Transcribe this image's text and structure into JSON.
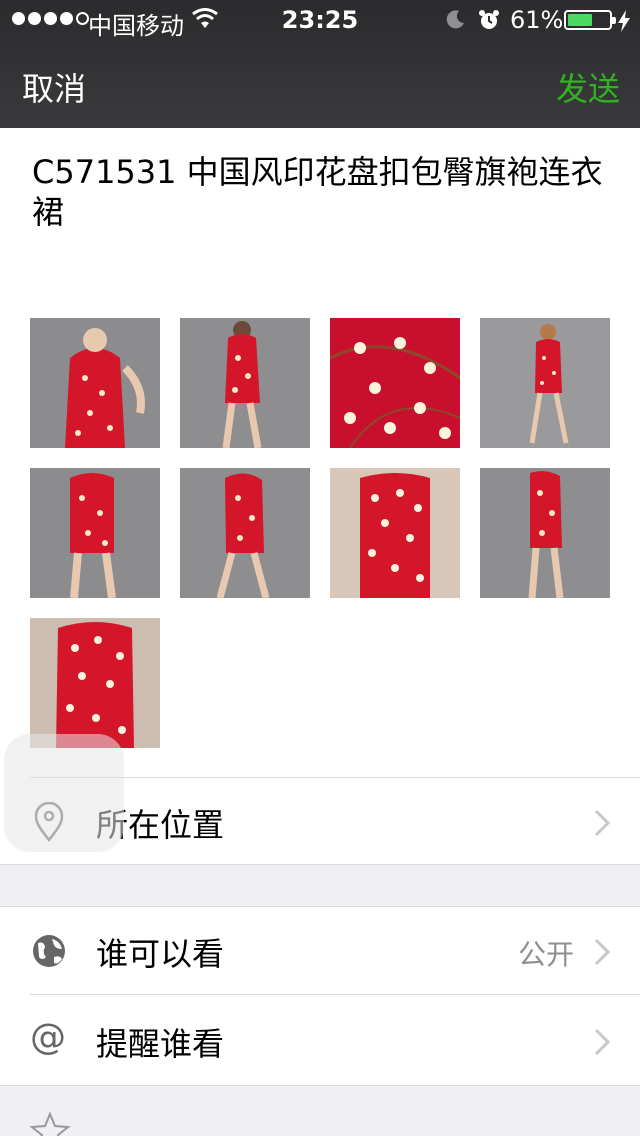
{
  "status_bar": {
    "carrier": "中国移动",
    "time": "23:25",
    "battery_percent": "61%",
    "battery_level": 0.61,
    "signal_bars": 4,
    "signal_total": 5
  },
  "nav": {
    "cancel_label": "取消",
    "send_label": "发送",
    "send_color": "#2fb320"
  },
  "post": {
    "text": "C571531  中国风印花盘扣包臀旗袍连衣裙",
    "image_count": 9
  },
  "rows": {
    "location": {
      "label": "所在位置",
      "icon": "location-pin-icon"
    },
    "visibility": {
      "label": "谁可以看",
      "value": "公开",
      "icon": "globe-icon"
    },
    "mention": {
      "label": "提醒谁看",
      "icon": "at-sign-icon",
      "glyph": "@"
    }
  },
  "colors": {
    "accent_green": "#2fb320",
    "dress_red": "#d4162a",
    "nav_bg": "#2b2b2d"
  }
}
